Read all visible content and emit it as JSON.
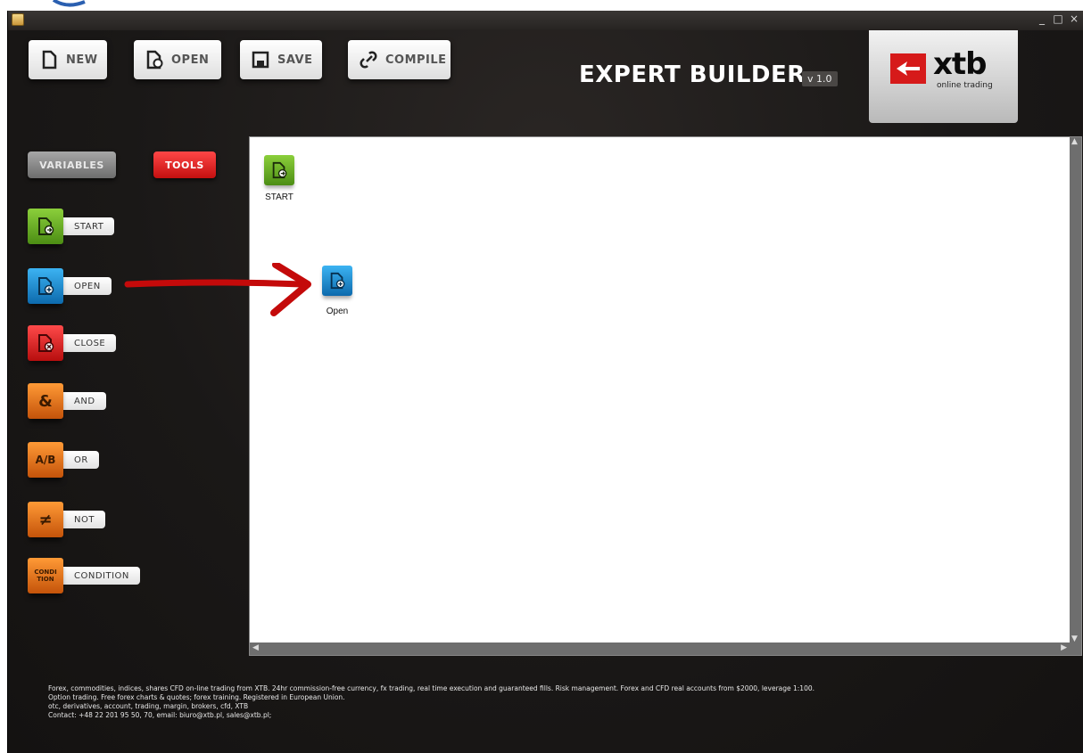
{
  "window": {
    "controls": [
      "_",
      "□",
      "×"
    ]
  },
  "toolbar": {
    "new_label": "NEW",
    "open_label": "OPEN",
    "save_label": "SAVE",
    "compile_label": "COMPILE"
  },
  "header": {
    "title": "EXPERT BUILDER",
    "version": "v 1.0",
    "logo_text": "xtb",
    "logo_subtext": "online trading"
  },
  "side_tabs": {
    "variables": "VARIABLES",
    "tools": "TOOLS"
  },
  "tools": {
    "start": "START",
    "open": "OPEN",
    "close": "CLOSE",
    "and": "AND",
    "and_glyph": "&",
    "or": "OR",
    "or_glyph": "A/B",
    "not": "NOT",
    "not_glyph": "≠",
    "condition": "CONDITION",
    "condition_glyph": "CONDI TION"
  },
  "canvas": {
    "nodes": {
      "start": "START",
      "open": "Open"
    }
  },
  "footer": {
    "line1": "Forex, commodities, indices, shares CFD on-line trading from XTB. 24hr commission-free currency, fx trading, real time execution and guaranteed fills. Risk management. Forex and CFD real accounts from $2000, leverage 1:100.",
    "line2": "Option trading. Free forex charts & quotes; forex training. Registered in European Union.",
    "line3": "otc, derivatives, account, trading, margin, brokers, cfd, XTB",
    "line4": "Contact: +48 22 201 95 50, 70, email: biuro@xtb.pl, sales@xtb.pl;"
  },
  "colors": {
    "accent_red": "#d61a1a",
    "tool_green": "#4c8d14",
    "tool_blue": "#0d6aad",
    "tool_orange": "#c4530a"
  }
}
